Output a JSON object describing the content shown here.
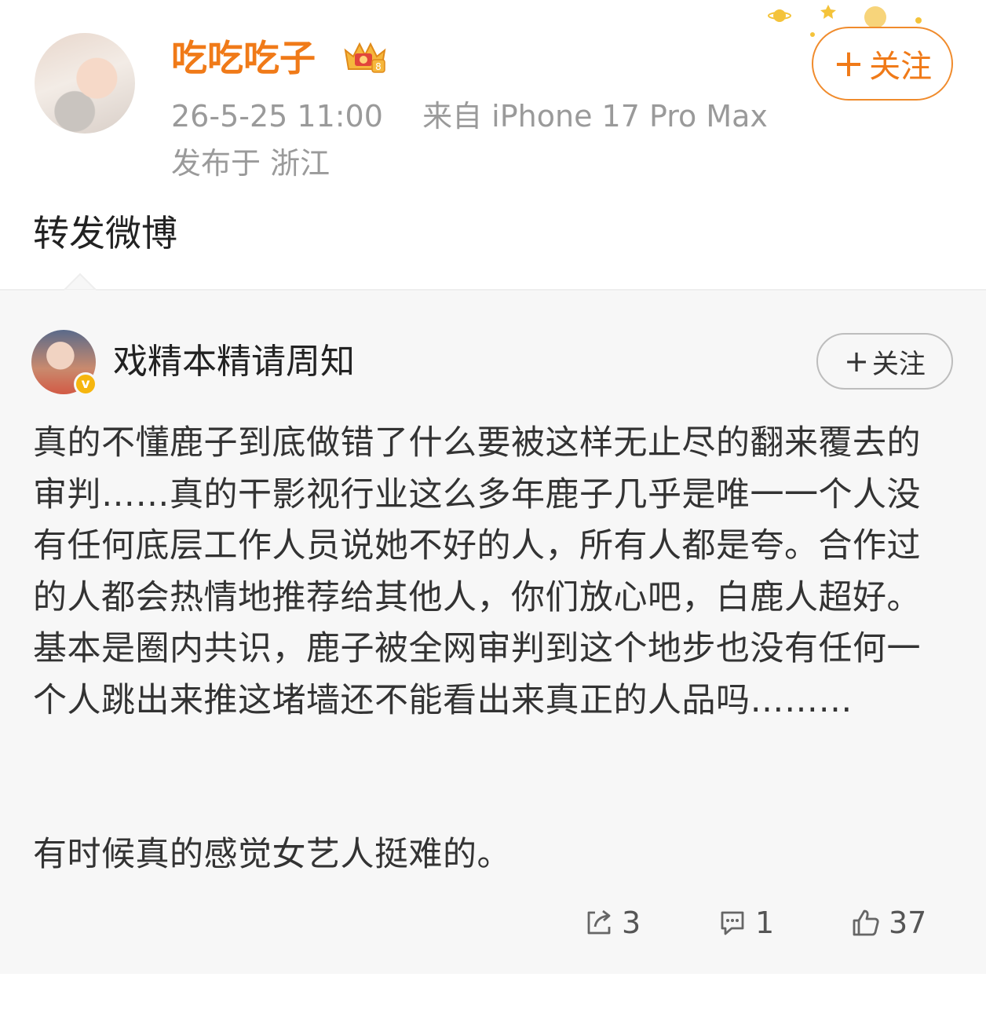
{
  "post": {
    "username": "吃吃吃子",
    "timestamp": "26-5-25 11:00",
    "source": "来自 iPhone 17 Pro Max",
    "location": "发布于 浙江",
    "text": "转发微博",
    "follow_label": "关注",
    "follow_plus": "+",
    "level_badge": "8"
  },
  "quoted": {
    "username": "戏精本精请周知",
    "verified_mark": "v",
    "follow_label": "关注",
    "follow_plus": "+",
    "paragraph1": "真的不懂鹿子到底做错了什么要被这样无止尽的翻来覆去的审判……真的干影视行业这么多年鹿子几乎是唯一一个人没有任何底层工作人员说她不好的人，所有人都是夸。合作过的人都会热情地推荐给其他人，你们放心吧，白鹿人超好。基本是圈内共识，鹿子被全网审判到这个地步也没有任何一个人跳出来推这堵墙还不能看出来真正的人品吗………",
    "paragraph2": "有时候真的感觉女艺人挺难的。",
    "stats": {
      "reposts": "3",
      "comments": "1",
      "likes": "37"
    }
  },
  "colors": {
    "brand_orange": "#f07a18",
    "meta_gray": "#9a9a9a",
    "quoted_bg": "#f7f7f7"
  },
  "icons": [
    "repost-icon",
    "comment-icon",
    "like-icon",
    "crown-badge-icon",
    "verified-icon"
  ]
}
